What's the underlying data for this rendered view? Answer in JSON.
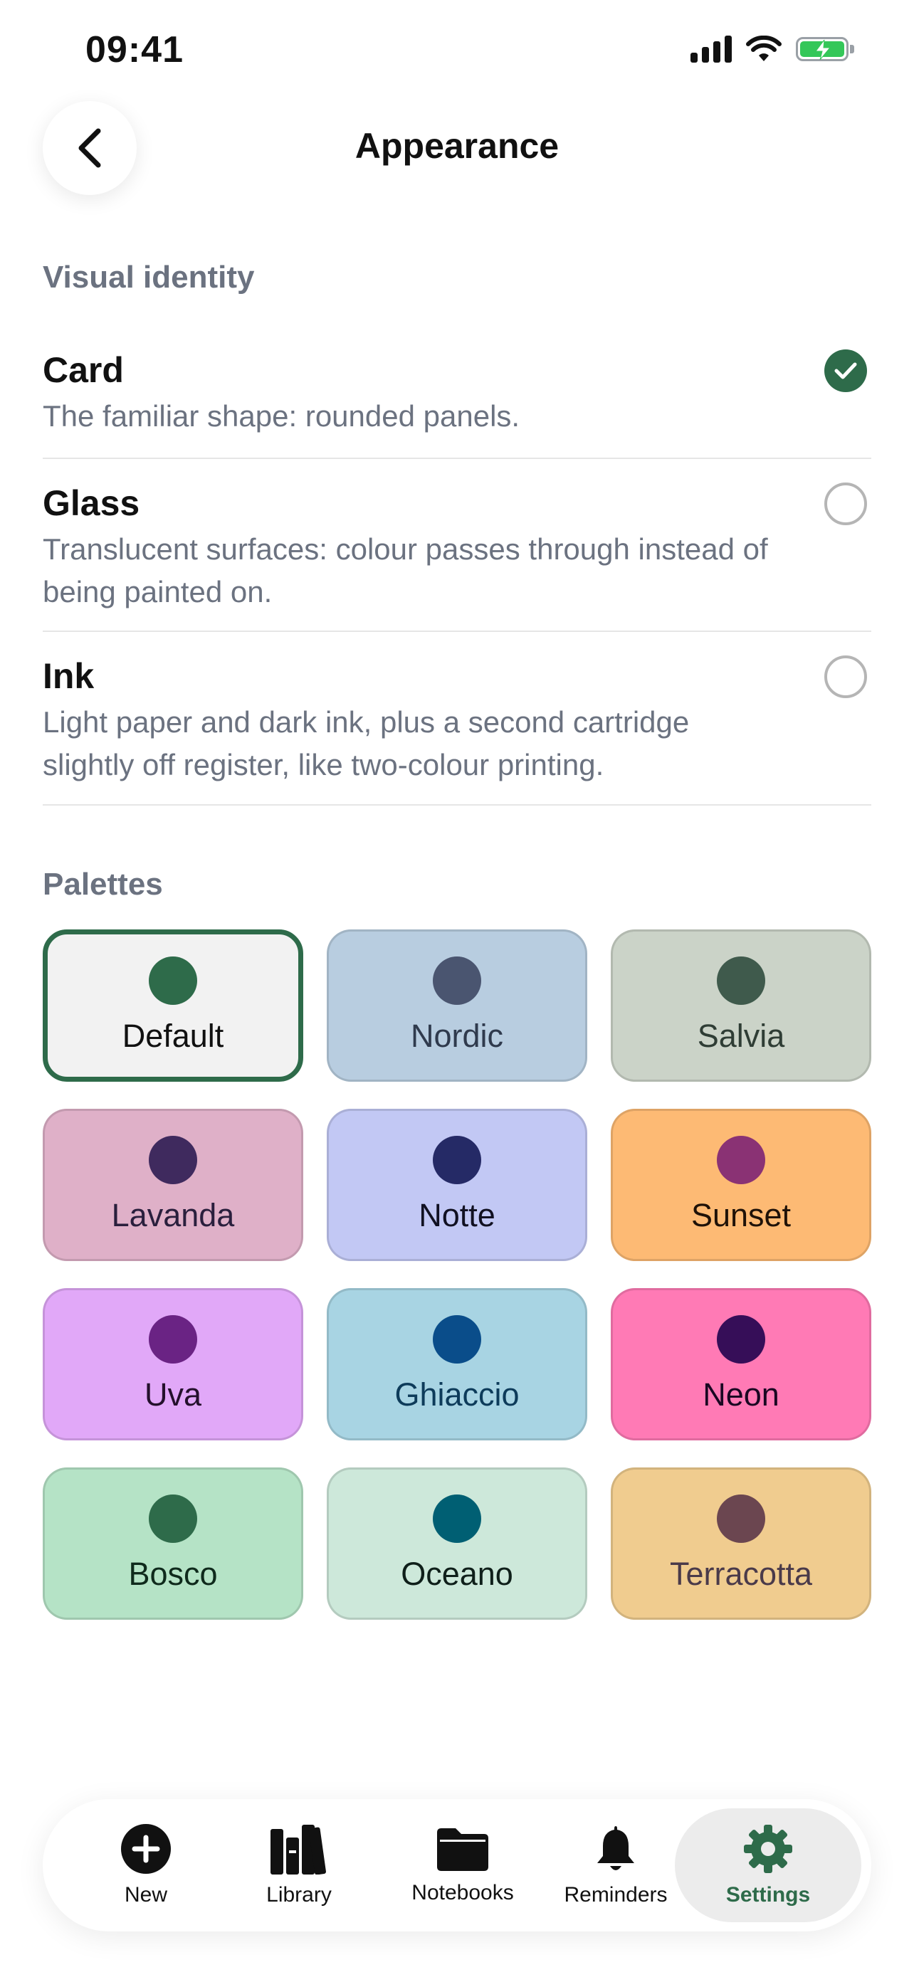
{
  "status_bar": {
    "time": "09:41"
  },
  "header": {
    "title": "Appearance"
  },
  "visual_identity": {
    "section_label": "Visual identity",
    "options": [
      {
        "name": "Card",
        "description": "The familiar shape: rounded panels.",
        "selected": true
      },
      {
        "name": "Glass",
        "description": "Translucent surfaces: colour passes through instead of being painted on.",
        "selected": false
      },
      {
        "name": "Ink",
        "description": "Light paper and dark ink, plus a second cartridge slightly off register, like two-colour printing.",
        "selected": false
      }
    ]
  },
  "palettes": {
    "section_label": "Palettes",
    "items": [
      {
        "name": "Default",
        "tile_color": "#f2f2f2",
        "swatch_color": "#2e6b4a",
        "text_color": "#111111",
        "selected": true
      },
      {
        "name": "Nordic",
        "tile_color": "#b8cde0",
        "swatch_color": "#4a5570",
        "text_color": "#2f3a4d",
        "selected": false
      },
      {
        "name": "Salvia",
        "tile_color": "#cbd3c8",
        "swatch_color": "#3f5a4c",
        "text_color": "#2f3d35",
        "selected": false
      },
      {
        "name": "Lavanda",
        "tile_color": "#dfb0c8",
        "swatch_color": "#3f2a5e",
        "text_color": "#2a1f3d",
        "selected": false
      },
      {
        "name": "Notte",
        "tile_color": "#c2c8f4",
        "swatch_color": "#252a66",
        "text_color": "#111122",
        "selected": false
      },
      {
        "name": "Sunset",
        "tile_color": "#fdba74",
        "swatch_color": "#8a3274",
        "text_color": "#1f1208",
        "selected": false
      },
      {
        "name": "Uva",
        "tile_color": "#e1a8f8",
        "swatch_color": "#6a2384",
        "text_color": "#24102c",
        "selected": false
      },
      {
        "name": "Ghiaccio",
        "tile_color": "#a8d4e3",
        "swatch_color": "#0a4d8a",
        "text_color": "#0d3b5a",
        "selected": false
      },
      {
        "name": "Neon",
        "tile_color": "#ff7ab5",
        "swatch_color": "#360e58",
        "text_color": "#1a0722",
        "selected": false
      },
      {
        "name": "Bosco",
        "tile_color": "#b5e3c6",
        "swatch_color": "#2e6b4a",
        "text_color": "#0f2a1c",
        "selected": false
      },
      {
        "name": "Oceano",
        "tile_color": "#cde8da",
        "swatch_color": "#005f73",
        "text_color": "#0f1f1a",
        "selected": false
      },
      {
        "name": "Terracotta",
        "tile_color": "#f0cc8f",
        "swatch_color": "#6b4650",
        "text_color": "#4a3a4a",
        "selected": false
      }
    ]
  },
  "tab_bar": {
    "tabs": [
      {
        "label": "New",
        "icon": "plus-circle-icon",
        "active": false
      },
      {
        "label": "Library",
        "icon": "books-icon",
        "active": false
      },
      {
        "label": "Notebooks",
        "icon": "folder-icon",
        "active": false
      },
      {
        "label": "Reminders",
        "icon": "bell-icon",
        "active": false
      },
      {
        "label": "Settings",
        "icon": "gear-icon",
        "active": true
      }
    ],
    "accent_color": "#2e6b4a"
  }
}
